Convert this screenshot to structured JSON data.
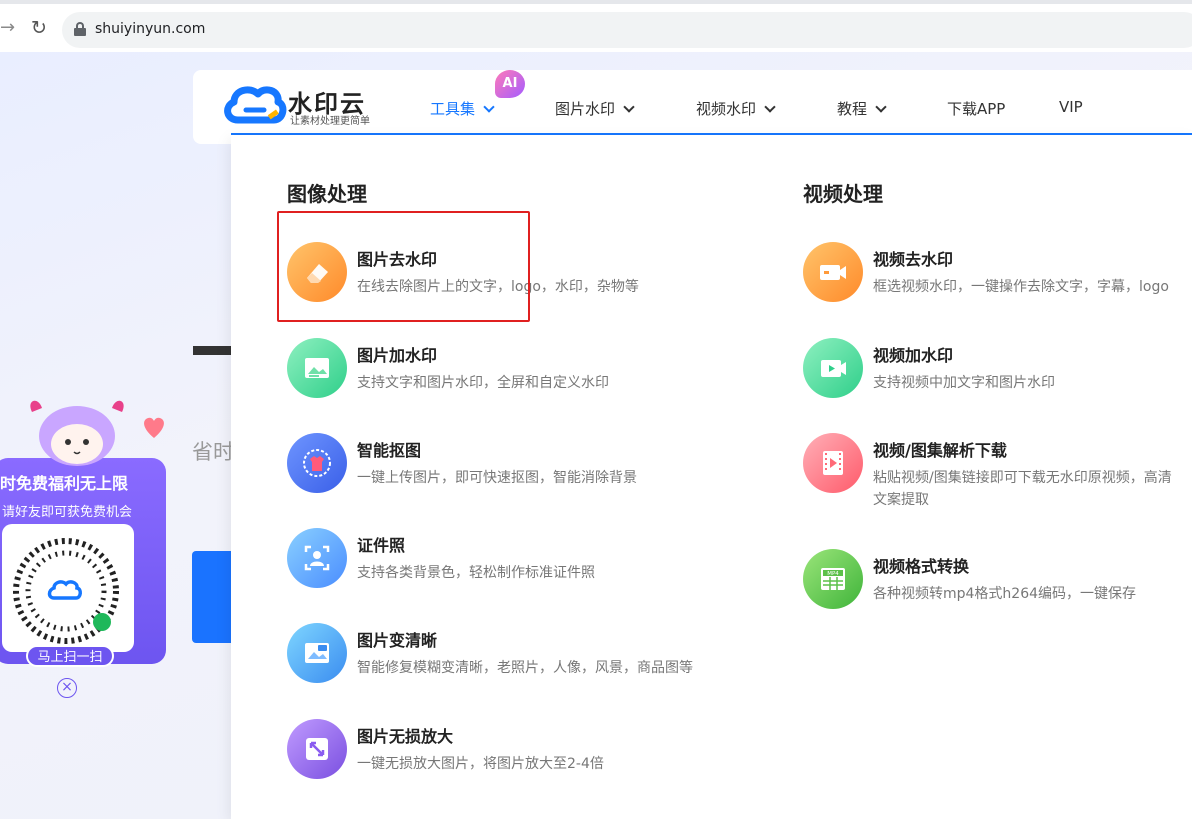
{
  "browser": {
    "url": "shuiyinyun.com"
  },
  "logo": {
    "name": "水印云",
    "tagline": "让素材处理更简单"
  },
  "nav": {
    "ai_badge": "AI",
    "items": [
      {
        "label": "工具集",
        "active": true
      },
      {
        "label": "图片水印"
      },
      {
        "label": "视频水印"
      },
      {
        "label": "教程"
      },
      {
        "label": "下载APP"
      },
      {
        "label": "VIP"
      }
    ]
  },
  "background": {
    "partial_text": "省时"
  },
  "promo": {
    "title": "时免费福利无上限",
    "subtitle": "请好友即可获免费机会",
    "scan_label": "马上扫一扫"
  },
  "dropdown": {
    "image_section": {
      "title": "图像处理",
      "tools": [
        {
          "title": "图片去水印",
          "desc": "在线去除图片上的文字，logo，水印，杂物等",
          "icon": "eraser-icon"
        },
        {
          "title": "图片加水印",
          "desc": "支持文字和图片水印，全屏和自定义水印",
          "icon": "image-add-icon"
        },
        {
          "title": "智能抠图",
          "desc": "一键上传图片，即可快速抠图，智能消除背景",
          "icon": "cutout-icon"
        },
        {
          "title": "证件照",
          "desc": "支持各类背景色，轻松制作标准证件照",
          "icon": "id-photo-icon"
        },
        {
          "title": "图片变清晰",
          "desc": "智能修复模糊变清晰，老照片，人像，风景，商品图等",
          "icon": "hd-icon"
        },
        {
          "title": "图片无损放大",
          "desc": "一键无损放大图片，将图片放大至2-4倍",
          "icon": "enlarge-icon"
        }
      ]
    },
    "video_section": {
      "title": "视频处理",
      "tools": [
        {
          "title": "视频去水印",
          "desc": "框选视频水印，一键操作去除文字，字幕，logo",
          "icon": "video-remove-icon"
        },
        {
          "title": "视频加水印",
          "desc": "支持视频中加文字和图片水印",
          "icon": "video-add-icon"
        },
        {
          "title": "视频/图集解析下载",
          "desc": "粘贴视频/图集链接即可下载无水印原视频，高清",
          "desc2": "文案提取",
          "icon": "film-icon"
        },
        {
          "title": "视频格式转换",
          "desc": "各种视频转mp4格式h264编码，一键保存",
          "icon": "mp4-icon"
        }
      ]
    }
  },
  "colors": {
    "accent": "#1677ff",
    "highlight": "#e02020",
    "promo": "#6d55f0"
  }
}
